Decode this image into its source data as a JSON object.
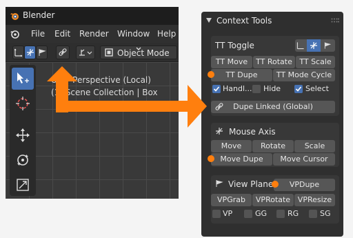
{
  "window": {
    "title": "Blender",
    "menu": [
      "File",
      "Edit",
      "Render",
      "Window",
      "Help"
    ],
    "mode_select": "Object Mode",
    "viewport": {
      "line1": "User Perspective (Local)",
      "line2": "(1) Scene Collection | Box"
    },
    "tools": [
      "select-box",
      "cursor",
      "move",
      "rotate",
      "scale"
    ]
  },
  "panel": {
    "title": "Context Tools",
    "tt_toggle": {
      "title": "TT Toggle",
      "buttons_row1": [
        "TT Move",
        "TT Rotate",
        "TT Scale"
      ],
      "buttons_row2": [
        "TT Dupe",
        "TT Mode Cycle"
      ],
      "checkboxes": [
        {
          "label": "Handl...",
          "checked": true
        },
        {
          "label": "Hide",
          "checked": false
        },
        {
          "label": "Select",
          "checked": true
        }
      ],
      "dupe_linked": "Dupe Linked (Global)"
    },
    "mouse_axis": {
      "title": "Mouse Axis",
      "buttons_row1": [
        "Move",
        "Rotate",
        "Scale"
      ],
      "buttons_row2": [
        "Move Dupe",
        "Move Cursor"
      ]
    },
    "view_plane": {
      "title": "View Plane",
      "vpdupe": "VPDupe",
      "buttons": [
        "VPGrab",
        "VPRotate",
        "VPResize"
      ],
      "checkboxes": [
        {
          "label": "VP",
          "checked": false
        },
        {
          "label": "GG",
          "checked": false
        },
        {
          "label": "RG",
          "checked": false
        },
        {
          "label": "SG",
          "checked": false
        }
      ]
    }
  },
  "colors": {
    "accent": "#4772b3",
    "highlight": "#ff7f0e",
    "panel_bg": "#2f2f2f",
    "box_bg": "#383838",
    "button_bg": "#565656"
  }
}
